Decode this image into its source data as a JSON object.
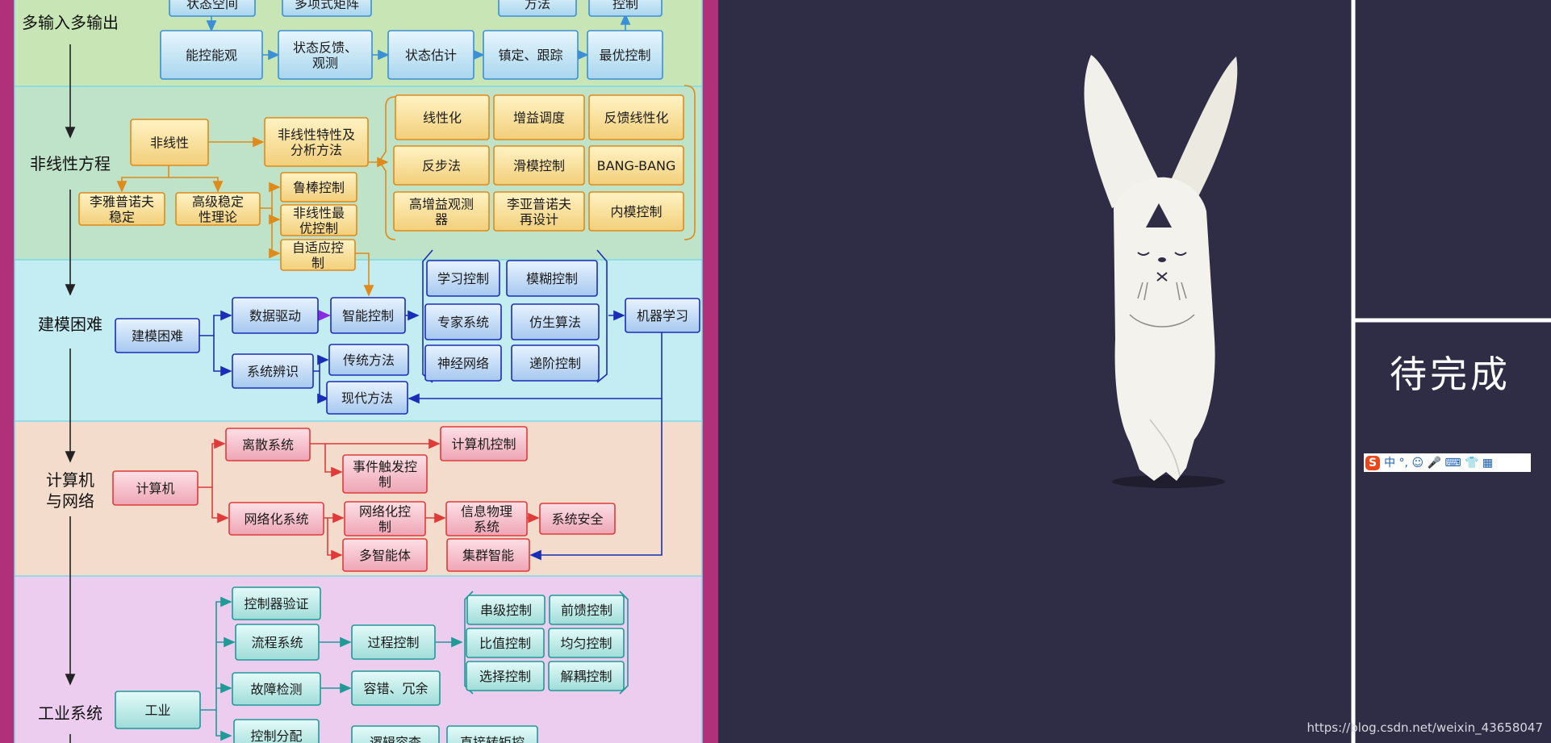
{
  "sections": [
    {
      "id": "mimo",
      "title": "多输入多输出"
    },
    {
      "id": "nonlinear",
      "title": "非线性方程"
    },
    {
      "id": "modeling",
      "title": "建模困难"
    },
    {
      "id": "computer",
      "title": "计算机\n与网络"
    },
    {
      "id": "industrial",
      "title": "工业系统"
    }
  ],
  "nodes": {
    "mimo_top1": "状态空间",
    "mimo_top2": "多项式矩阵",
    "mimo_top3": "方法",
    "mimo_top4": "控制",
    "controllability": "能控能观",
    "state_feedback": "状态反馈、\n观测",
    "state_estimation": "状态估计",
    "stabilize_track": "镇定、跟踪",
    "optimal_control": "最优控制",
    "nonlinearity": "非线性",
    "nl_analysis": "非线性特性及\n分析方法",
    "lyapunov": "李雅普诺夫\n稳定",
    "adv_stability": "高级稳定\n性理论",
    "robust": "鲁棒控制",
    "nl_optimal": "非线性最\n优控制",
    "adaptive": "自适应控\n制",
    "linearization": "线性化",
    "gain_sched": "增益调度",
    "fb_linearization": "反馈线性化",
    "backstepping": "反步法",
    "sliding_mode": "滑模控制",
    "bang_bang": "BANG-BANG",
    "high_gain_obs": "高增益观测\n器",
    "lyap_redesign": "李亚普诺夫\n再设计",
    "imc": "内模控制",
    "model_difficulty": "建模困难",
    "data_driven": "数据驱动",
    "intelligent": "智能控制",
    "sys_id": "系统辨识",
    "traditional": "传统方法",
    "modern": "现代方法",
    "learning": "学习控制",
    "fuzzy": "模糊控制",
    "expert": "专家系统",
    "bionic": "仿生算法",
    "neural": "神经网络",
    "hierarchical": "递阶控制",
    "ml": "机器学习",
    "computer": "计算机",
    "discrete": "离散系统",
    "computer_control": "计算机控制",
    "event_trigger": "事件触发控\n制",
    "networked_sys": "网络化系统",
    "networked_ctrl": "网络化控\n制",
    "cps": "信息物理\n系统",
    "sys_security": "系统安全",
    "multi_agent": "多智能体",
    "swarm": "集群智能",
    "industrial": "工业",
    "ctrl_verify": "控制器验证",
    "process_sys": "流程系统",
    "process_ctrl": "过程控制",
    "fault_detect": "故障检测",
    "fault_tol": "容错、冗余",
    "ctrl_alloc": "控制分配",
    "latter_block": "逻辑容查",
    "direct_torque": "直接转矩控",
    "cascade": "串级控制",
    "feedforward": "前馈控制",
    "ratio": "比值控制",
    "uniform": "均匀控制",
    "selective": "选择控制",
    "decoupling": "解耦控制"
  },
  "right_panel": {
    "pending_label": "待完成",
    "ime_label": "中 °, ☺ 🎤 ⌨ 👕 ▦",
    "ime_logo": "S",
    "watermark": "https://blog.csdn.net/weixin_43658047"
  },
  "colors": {
    "band_mimo": "#c8e6b5",
    "band_nonlinear": "#bfe3c8",
    "band_modeling": "#c3ecf3",
    "band_computer": "#f3dccb",
    "band_industrial": "#eccdf0",
    "blue_edge": "#3b8fd6",
    "orange_edge": "#e08a1a",
    "navy_edge": "#1a2db8",
    "red_edge": "#e03a3a",
    "teal_edge": "#1f9a97",
    "page_bg": "#2f2c45",
    "left_bar": "#b0307a"
  }
}
